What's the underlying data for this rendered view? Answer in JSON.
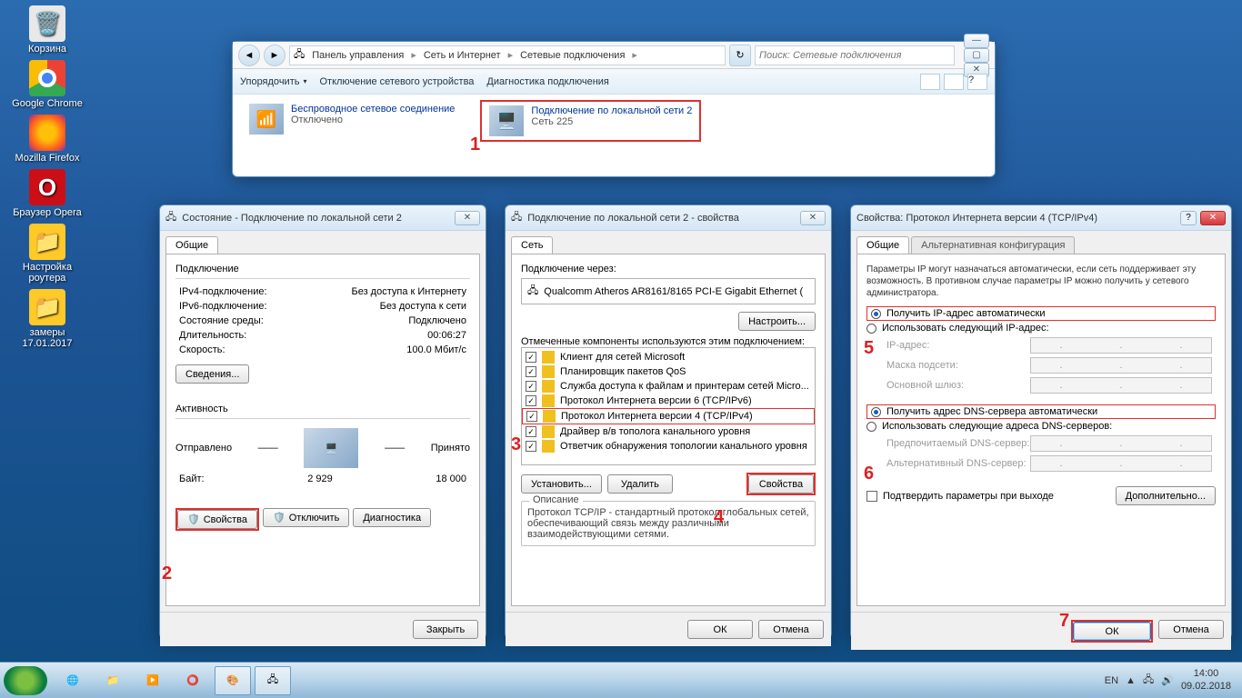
{
  "desktop": {
    "icons": [
      "Корзина",
      "Google Chrome",
      "Mozilla Firefox",
      "Браузер Opera",
      "Настройка роутера",
      "замеры 17.01.2017"
    ]
  },
  "explorer": {
    "breadcrumbs": [
      "Панель управления",
      "Сеть и Интернет",
      "Сетевые подключения"
    ],
    "search_placeholder": "Поиск: Сетевые подключения",
    "toolbar": {
      "organize": "Упорядочить",
      "disable": "Отключение сетевого устройства",
      "diag": "Диагностика подключения"
    },
    "conn1": {
      "title": "Беспроводное сетевое соединение",
      "status": "Отключено"
    },
    "conn2": {
      "title": "Подключение по локальной сети 2",
      "status": "Сеть 225"
    }
  },
  "status": {
    "title": "Состояние - Подключение по локальной сети 2",
    "tab": "Общие",
    "grp_conn": "Подключение",
    "ipv4_l": "IPv4-подключение:",
    "ipv4_v": "Без доступа к Интернету",
    "ipv6_l": "IPv6-подключение:",
    "ipv6_v": "Без доступа к сети",
    "state_l": "Состояние среды:",
    "state_v": "Подключено",
    "dur_l": "Длительность:",
    "dur_v": "00:06:27",
    "speed_l": "Скорость:",
    "speed_v": "100.0 Мбит/с",
    "details": "Сведения...",
    "grp_act": "Активность",
    "sent": "Отправлено",
    "recv": "Принято",
    "bytes_l": "Байт:",
    "bytes_sent": "2 929",
    "bytes_recv": "18 000",
    "props": "Свойства",
    "disable": "Отключить",
    "diag": "Диагностика",
    "close": "Закрыть"
  },
  "props": {
    "title": "Подключение по локальной сети 2 - свойства",
    "tab": "Сеть",
    "conn_via": "Подключение через:",
    "adapter": "Qualcomm Atheros AR8161/8165 PCI-E Gigabit Ethernet (",
    "configure": "Настроить...",
    "components_label": "Отмеченные компоненты используются этим подключением:",
    "items": [
      "Клиент для сетей Microsoft",
      "Планировщик пакетов QoS",
      "Служба доступа к файлам и принтерам сетей Micro...",
      "Протокол Интернета версии 6 (TCP/IPv6)",
      "Протокол Интернета версии 4 (TCP/IPv4)",
      "Драйвер в/в тополога канального уровня",
      "Ответчик обнаружения топологии канального уровня"
    ],
    "install": "Установить...",
    "remove": "Удалить",
    "properties": "Свойства",
    "desc_title": "Описание",
    "desc": "Протокол TCP/IP - стандартный протокол глобальных сетей, обеспечивающий связь между различными взаимодействующими сетями.",
    "ok": "ОК",
    "cancel": "Отмена"
  },
  "tcpip": {
    "title": "Свойства: Протокол Интернета версии 4 (TCP/IPv4)",
    "tab1": "Общие",
    "tab2": "Альтернативная конфигурация",
    "intro": "Параметры IP могут назначаться автоматически, если сеть поддерживает эту возможность. В противном случае параметры IP можно получить у сетевого администратора.",
    "r_auto_ip": "Получить IP-адрес автоматически",
    "r_man_ip": "Использовать следующий IP-адрес:",
    "ip_l": "IP-адрес:",
    "mask_l": "Маска подсети:",
    "gw_l": "Основной шлюз:",
    "r_auto_dns": "Получить адрес DNS-сервера автоматически",
    "r_man_dns": "Использовать следующие адреса DNS-серверов:",
    "dns1_l": "Предпочитаемый DNS-сервер:",
    "dns2_l": "Альтернативный DNS-сервер:",
    "validate": "Подтвердить параметры при выходе",
    "advanced": "Дополнительно...",
    "ok": "ОК",
    "cancel": "Отмена"
  },
  "taskbar": {
    "lang": "EN",
    "time": "14:00",
    "date": "09.02.2018"
  },
  "callouts": {
    "n1": "1",
    "n2": "2",
    "n3": "3",
    "n4": "4",
    "n5": "5",
    "n6": "6",
    "n7": "7"
  }
}
